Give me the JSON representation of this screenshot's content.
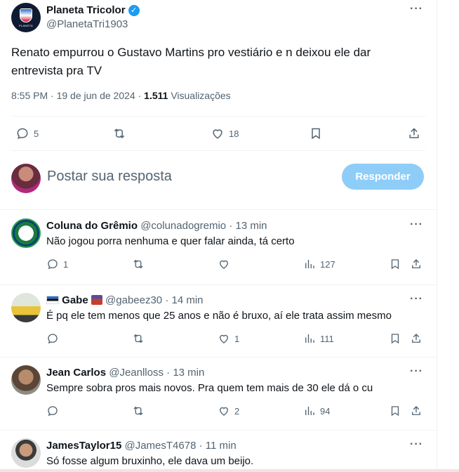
{
  "tweet": {
    "author_name": "Planeta Tricolor",
    "author_handle": "@PlanetaTri1903",
    "avatar_text": "PLANETA",
    "text": "Renato empurrou o Gustavo Martins pro vestiário e n deixou ele dar entrevista pra TV",
    "time": "8:55 PM",
    "date": "19 de jun de 2024",
    "views_count": "1.511",
    "views_label": "Visualizações",
    "replies": "5",
    "retweets": "",
    "likes": "18"
  },
  "composer": {
    "placeholder": "Postar sua resposta",
    "button_label": "Responder"
  },
  "replies": [
    {
      "name": "Coluna do Grêmio",
      "handle": "@colunadogremio",
      "time": "13 min",
      "text": "Não jogou porra nenhuma e quer falar ainda, tá certo",
      "reply_count": "1",
      "retweet_count": "",
      "like_count": "",
      "views": "127"
    },
    {
      "name": "Gabe",
      "handle": "@gabeez30",
      "time": "14 min",
      "text": "É pq ele tem menos que 25 anos e não é bruxo, aí ele trata assim mesmo",
      "reply_count": "",
      "retweet_count": "",
      "like_count": "1",
      "views": "111"
    },
    {
      "name": "Jean Carlos",
      "handle": "@Jeanlloss",
      "time": "13 min",
      "text": "Sempre sobra pros mais novos. Pra quem tem mais de 30 ele dá o cu",
      "reply_count": "",
      "retweet_count": "",
      "like_count": "2",
      "views": "94"
    },
    {
      "name": "JamesTaylor15",
      "handle": "@JamesT4678",
      "time": "11 min",
      "text": "Só fosse algum bruxinho, ele dava um beijo."
    }
  ],
  "separator": "·",
  "more": "···",
  "colors": {
    "accent": "#1d9bf0",
    "button_disabled": "#8ecdf8",
    "muted": "#536471"
  }
}
